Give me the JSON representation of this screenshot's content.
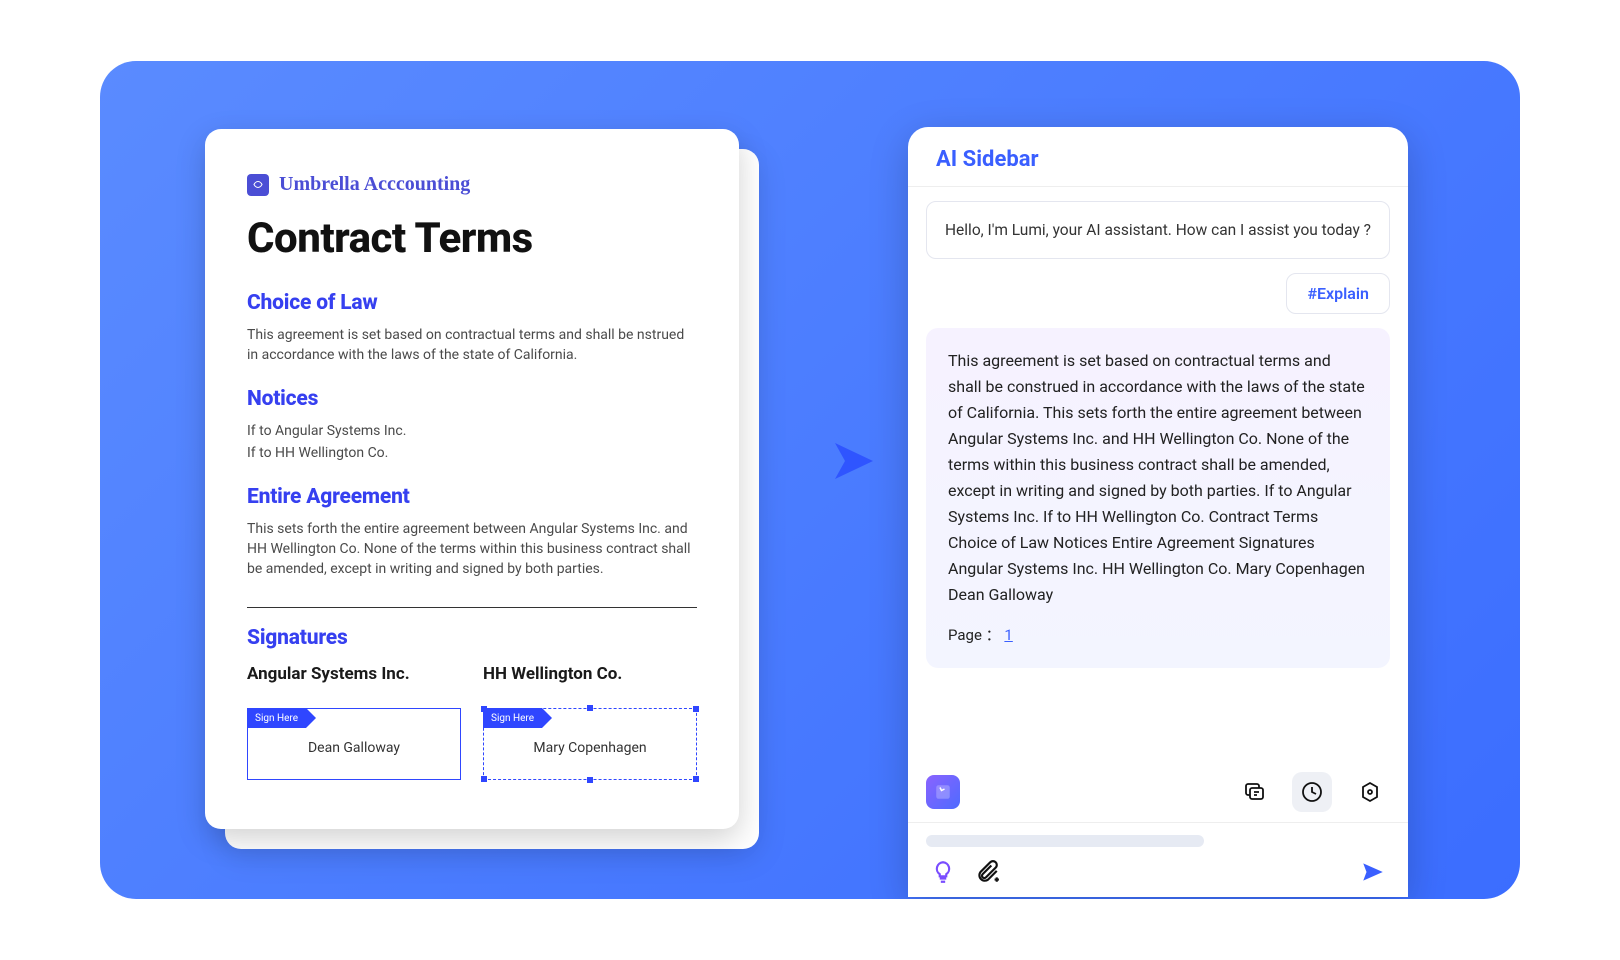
{
  "document": {
    "brand": "Umbrella Acccounting",
    "title": "Contract Terms",
    "sections": {
      "choice_of_law": {
        "heading": "Choice of Law",
        "body": "This agreement is set based on contractual terms and shall be nstrued in accordance with the laws of the state of California."
      },
      "notices": {
        "heading": "Notices",
        "lines": [
          "If to Angular Systems Inc.",
          "If to HH Wellington Co."
        ]
      },
      "entire_agreement": {
        "heading": "Entire Agreement",
        "body": "This sets forth the entire agreement between Angular Systems Inc. and HH Wellington Co. None of the terms within this business contract shall be amended, except in writing and signed by both parties."
      },
      "signatures": {
        "heading": "Signatures",
        "cols": [
          {
            "company": "Angular Systems Inc.",
            "tag": "Sign Here",
            "name": "Dean Galloway"
          },
          {
            "company": "HH Wellington Co.",
            "tag": "Sign Here",
            "name": "Mary Copenhagen"
          }
        ]
      }
    }
  },
  "sidebar": {
    "title": "AI Sidebar",
    "greeting": "Hello, I'm Lumi, your AI assistant. How can I assist you today ?",
    "command": "#Explain",
    "response": "This agreement is set based on contractual terms and shall be construed in accordance with the laws of the state of California. This sets forth the entire agreement between Angular Systems Inc. and HH Wellington Co. None of the terms within this business contract shall be amended, except in writing and signed by both parties. If to Angular Systems Inc. If to HH Wellington Co. Contract Terms Choice of Law Notices Entire Agreement Signatures Angular Systems Inc. HH Wellington Co. Mary Copenhagen Dean Galloway",
    "page_label": "Page ：",
    "page_number": "1"
  }
}
